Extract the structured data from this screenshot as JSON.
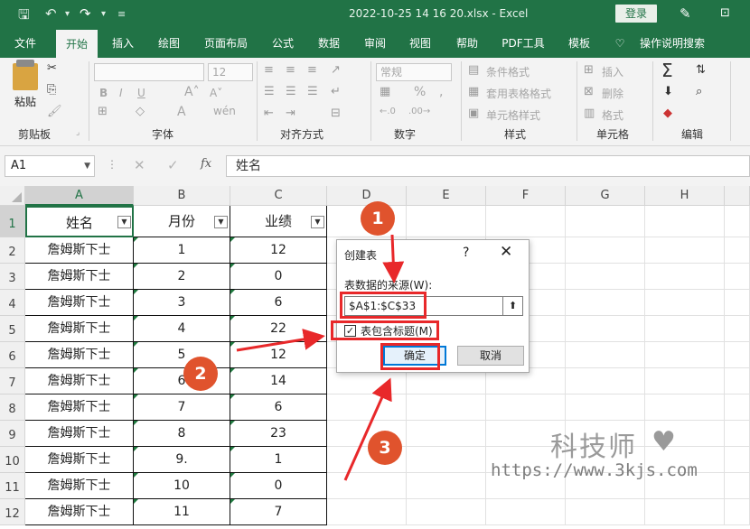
{
  "titlebar": {
    "doc_title": "2022-10-25 14 16 20.xlsx  -  Excel",
    "login": "登录"
  },
  "tabs": [
    "文件",
    "开始",
    "插入",
    "绘图",
    "页面布局",
    "公式",
    "数据",
    "审阅",
    "视图",
    "帮助",
    "PDF工具",
    "模板",
    "操作说明搜索"
  ],
  "ribbon": {
    "paste": "粘贴",
    "groups": [
      "剪贴板",
      "字体",
      "对齐方式",
      "数字",
      "样式",
      "单元格",
      "编辑"
    ],
    "font_size": "12",
    "number_format": "常规",
    "styles": [
      "条件格式",
      "套用表格格式",
      "单元格样式"
    ],
    "cells": [
      "插入",
      "删除",
      "格式"
    ]
  },
  "formula": {
    "namebox": "A1",
    "fx": "fx",
    "content": "姓名"
  },
  "columns": [
    "A",
    "B",
    "C",
    "D",
    "E",
    "F",
    "G",
    "H"
  ],
  "rows": [
    "1",
    "2",
    "3",
    "4",
    "5",
    "6",
    "7",
    "8",
    "9",
    "10",
    "11",
    "12"
  ],
  "header_row": [
    "姓名",
    "月份",
    "业绩"
  ],
  "table_rows": [
    [
      "詹姆斯下士",
      "1",
      "12"
    ],
    [
      "詹姆斯下士",
      "2",
      "0"
    ],
    [
      "詹姆斯下士",
      "3",
      "6"
    ],
    [
      "詹姆斯下士",
      "4",
      "22"
    ],
    [
      "詹姆斯下士",
      "5",
      "12"
    ],
    [
      "詹姆斯下士",
      "6",
      "14"
    ],
    [
      "詹姆斯下士",
      "7",
      "6"
    ],
    [
      "詹姆斯下士",
      "8",
      "23"
    ],
    [
      "詹姆斯下士",
      "9.",
      "1"
    ],
    [
      "詹姆斯下士",
      "10",
      "0"
    ],
    [
      "詹姆斯下士",
      "11",
      "7"
    ]
  ],
  "dialog": {
    "title": "创建表",
    "help": "?",
    "close": "✕",
    "source_label": "表数据的来源(W):",
    "range": "$A$1:$C$33",
    "has_headers_label": "表包含标题(M)",
    "has_headers_checked": true,
    "ok": "确定",
    "cancel": "取消"
  },
  "badges": [
    "1",
    "2",
    "3"
  ],
  "watermark": {
    "brand": "科技师",
    "url": "https://www.3kjs.com"
  },
  "colors": {
    "excel_green": "#217346",
    "annotation_red": "#e8282a",
    "badge_orange": "#e0532d"
  }
}
